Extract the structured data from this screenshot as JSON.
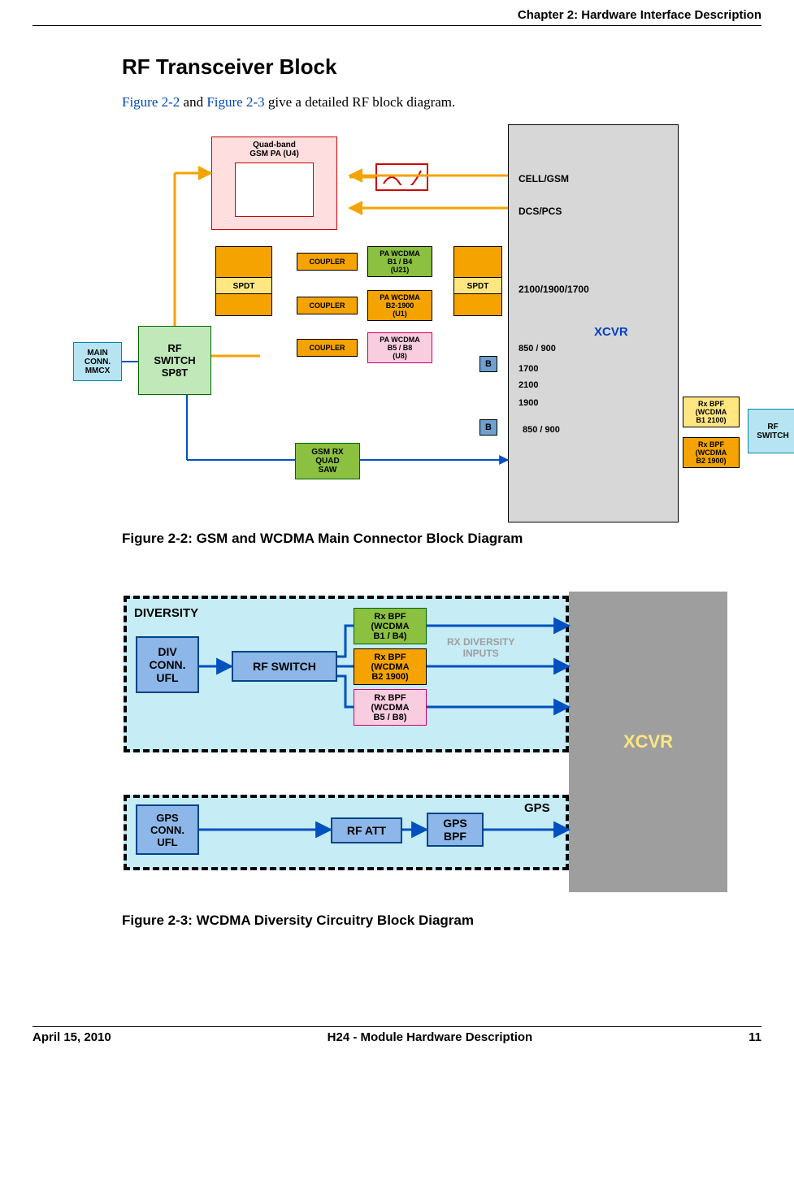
{
  "header": {
    "chapter": "Chapter 2:  Hardware Interface Description"
  },
  "section": {
    "title": "RF Transceiver Block"
  },
  "intro": {
    "pre": "",
    "link1": "Figure 2-2",
    "mid": " and ",
    "link2": "Figure 2-3",
    "post": " give a detailed RF block diagram."
  },
  "fig1": {
    "caption": "Figure 2-2: GSM and WCDMA Main Connector Block Diagram",
    "quad_band": "Quad-band\nGSM PA (U4)",
    "spdt_l": "SPDT",
    "spdt_r": "SPDT",
    "coupler1": "COUPLER",
    "coupler2": "COUPLER",
    "coupler3": "COUPLER",
    "pa1": "PA WCDMA\nB1 / B4\n(U21)",
    "pa2": "PA WCDMA\nB2-1900\n(U1)",
    "pa3": "PA WCDMA\nB5 / B8\n(U8)",
    "b1": "B",
    "b2": "B",
    "gsm_saw": "GSM RX\nQUAD\nSAW",
    "main_conn": "MAIN\nCONN.\nMMCX",
    "rf_switch_sp8t": "RF\nSWITCH\nSP8T",
    "xcvr": "XCVR",
    "rf_switch": "RF\nSWITCH",
    "rxbpf1": "Rx BPF\n(WCDMA\nB1 2100)",
    "rxbpf2": "Rx BPF\n(WCDMA\nB2 1900)",
    "ports": {
      "cell_gsm": "CELL/GSM",
      "dcs_pcs": "DCS/PCS",
      "w2100": "2100/1900/1700",
      "p850": "850 / 900",
      "p1700": "1700",
      "p2100": "2100",
      "p1900": "1900",
      "p850b": "850 / 900"
    }
  },
  "fig2": {
    "caption": "Figure 2-3: WCDMA Diversity Circuitry Block Diagram",
    "diversity": "DIVERSITY",
    "div_conn": "DIV\nCONN.\nUFL",
    "rf_switch": "RF SWITCH",
    "rxbpf1": "Rx BPF\n(WCDMA\nB1 / B4)",
    "rxbpf2": "Rx BPF\n(WCDMA\nB2 1900)",
    "rxbpf3": "Rx BPF\n(WCDMA\nB5 / B8)",
    "rx_div": "RX DIVERSITY\nINPUTS",
    "gps": "GPS",
    "gps_conn": "GPS\nCONN.\nUFL",
    "rf_att": "RF ATT",
    "gps_bpf": "GPS\nBPF",
    "xcvr": "XCVR"
  },
  "footer": {
    "date": "April 15, 2010",
    "doc": "H24 - Module Hardware Description",
    "page": "11"
  }
}
